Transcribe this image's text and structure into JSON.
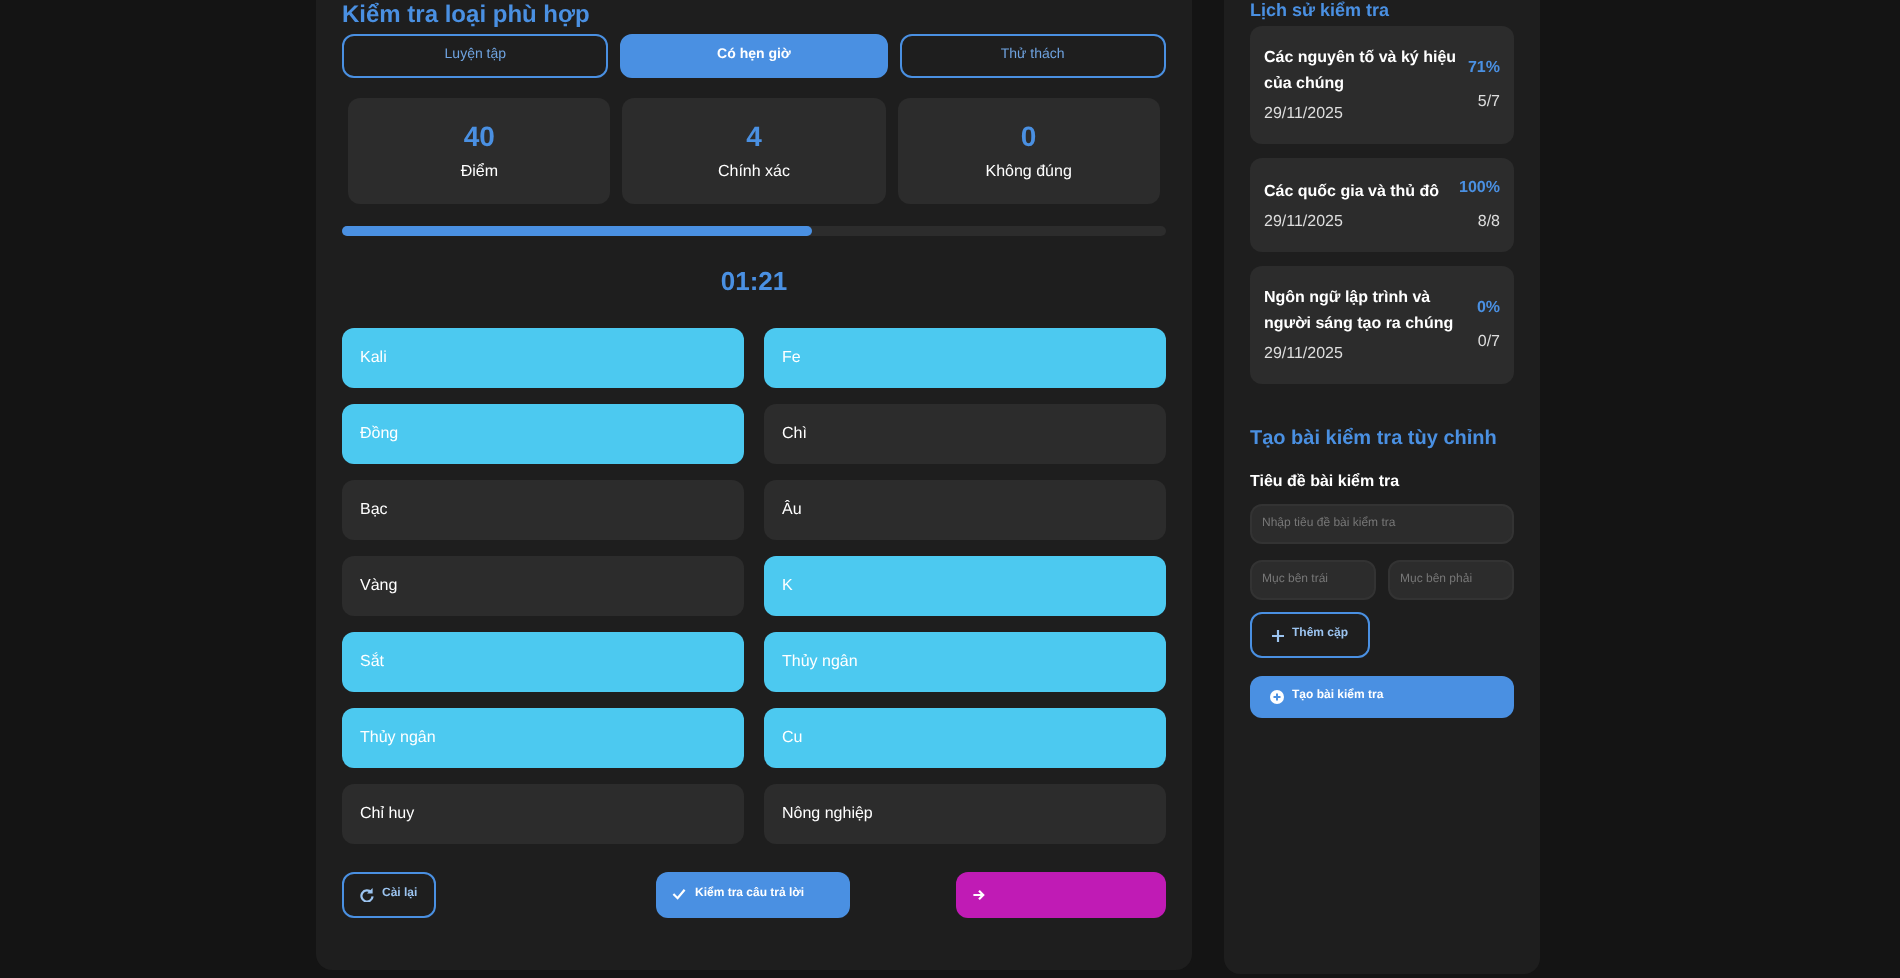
{
  "quiz": {
    "title": "Kiểm tra loại phù hợp",
    "modes": [
      {
        "label": "Luyện tập",
        "selected": false
      },
      {
        "label": "Có hẹn giờ",
        "selected": true
      },
      {
        "label": "Thử thách",
        "selected": false
      }
    ],
    "stats": [
      {
        "value": "40",
        "label": "Điểm"
      },
      {
        "value": "4",
        "label": "Chính xác"
      },
      {
        "value": "0",
        "label": "Không đúng"
      }
    ],
    "progress": {
      "level": 0.57
    },
    "timer": "01:21",
    "left_items": [
      {
        "label": "Kali",
        "matched": true
      },
      {
        "label": "Đồng",
        "matched": true
      },
      {
        "label": "Bạc",
        "matched": false
      },
      {
        "label": "Vàng",
        "matched": false
      },
      {
        "label": "Sắt",
        "matched": true
      },
      {
        "label": "Thủy ngân",
        "matched": true
      },
      {
        "label": "Chỉ huy",
        "matched": false
      }
    ],
    "right_items": [
      {
        "label": "Fe",
        "matched": true
      },
      {
        "label": "Chì",
        "matched": false
      },
      {
        "label": "Âu",
        "matched": false
      },
      {
        "label": "K",
        "matched": true
      },
      {
        "label": "Thủy ngân",
        "matched": true
      },
      {
        "label": "Cu",
        "matched": true
      },
      {
        "label": "Nông nghiệp",
        "matched": false
      }
    ],
    "buttons": [
      {
        "kind": "reset",
        "label": "Cài lại"
      },
      {
        "kind": "check",
        "label": "Kiểm tra câu trả lời"
      },
      {
        "kind": "next"
      }
    ]
  },
  "history": {
    "title": "Lịch sử kiểm tra",
    "items": [
      {
        "name": "Các nguyên tố và ký hiệu của chúng",
        "date": "29/11/2025",
        "percent": "71%",
        "score": "5/7"
      },
      {
        "name": "Các quốc gia và thủ đô",
        "date": "29/11/2025",
        "percent": "100%",
        "score": "8/8"
      },
      {
        "name": "Ngôn ngữ lập trình và người sáng tạo ra chúng",
        "date": "29/11/2025",
        "percent": "0%",
        "score": "0/7"
      }
    ]
  },
  "custom": {
    "title": "Tạo bài kiểm tra tùy chỉnh",
    "field_label": "Tiêu đề bài kiểm tra",
    "title_placeholder": "Nhập tiêu đề bài kiểm tra",
    "left_placeholder": "Mục bên trái",
    "right_placeholder": "Mục bên phải",
    "add_button": "Thêm cặp",
    "create_button": "Tạo bài kiểm tra"
  }
}
